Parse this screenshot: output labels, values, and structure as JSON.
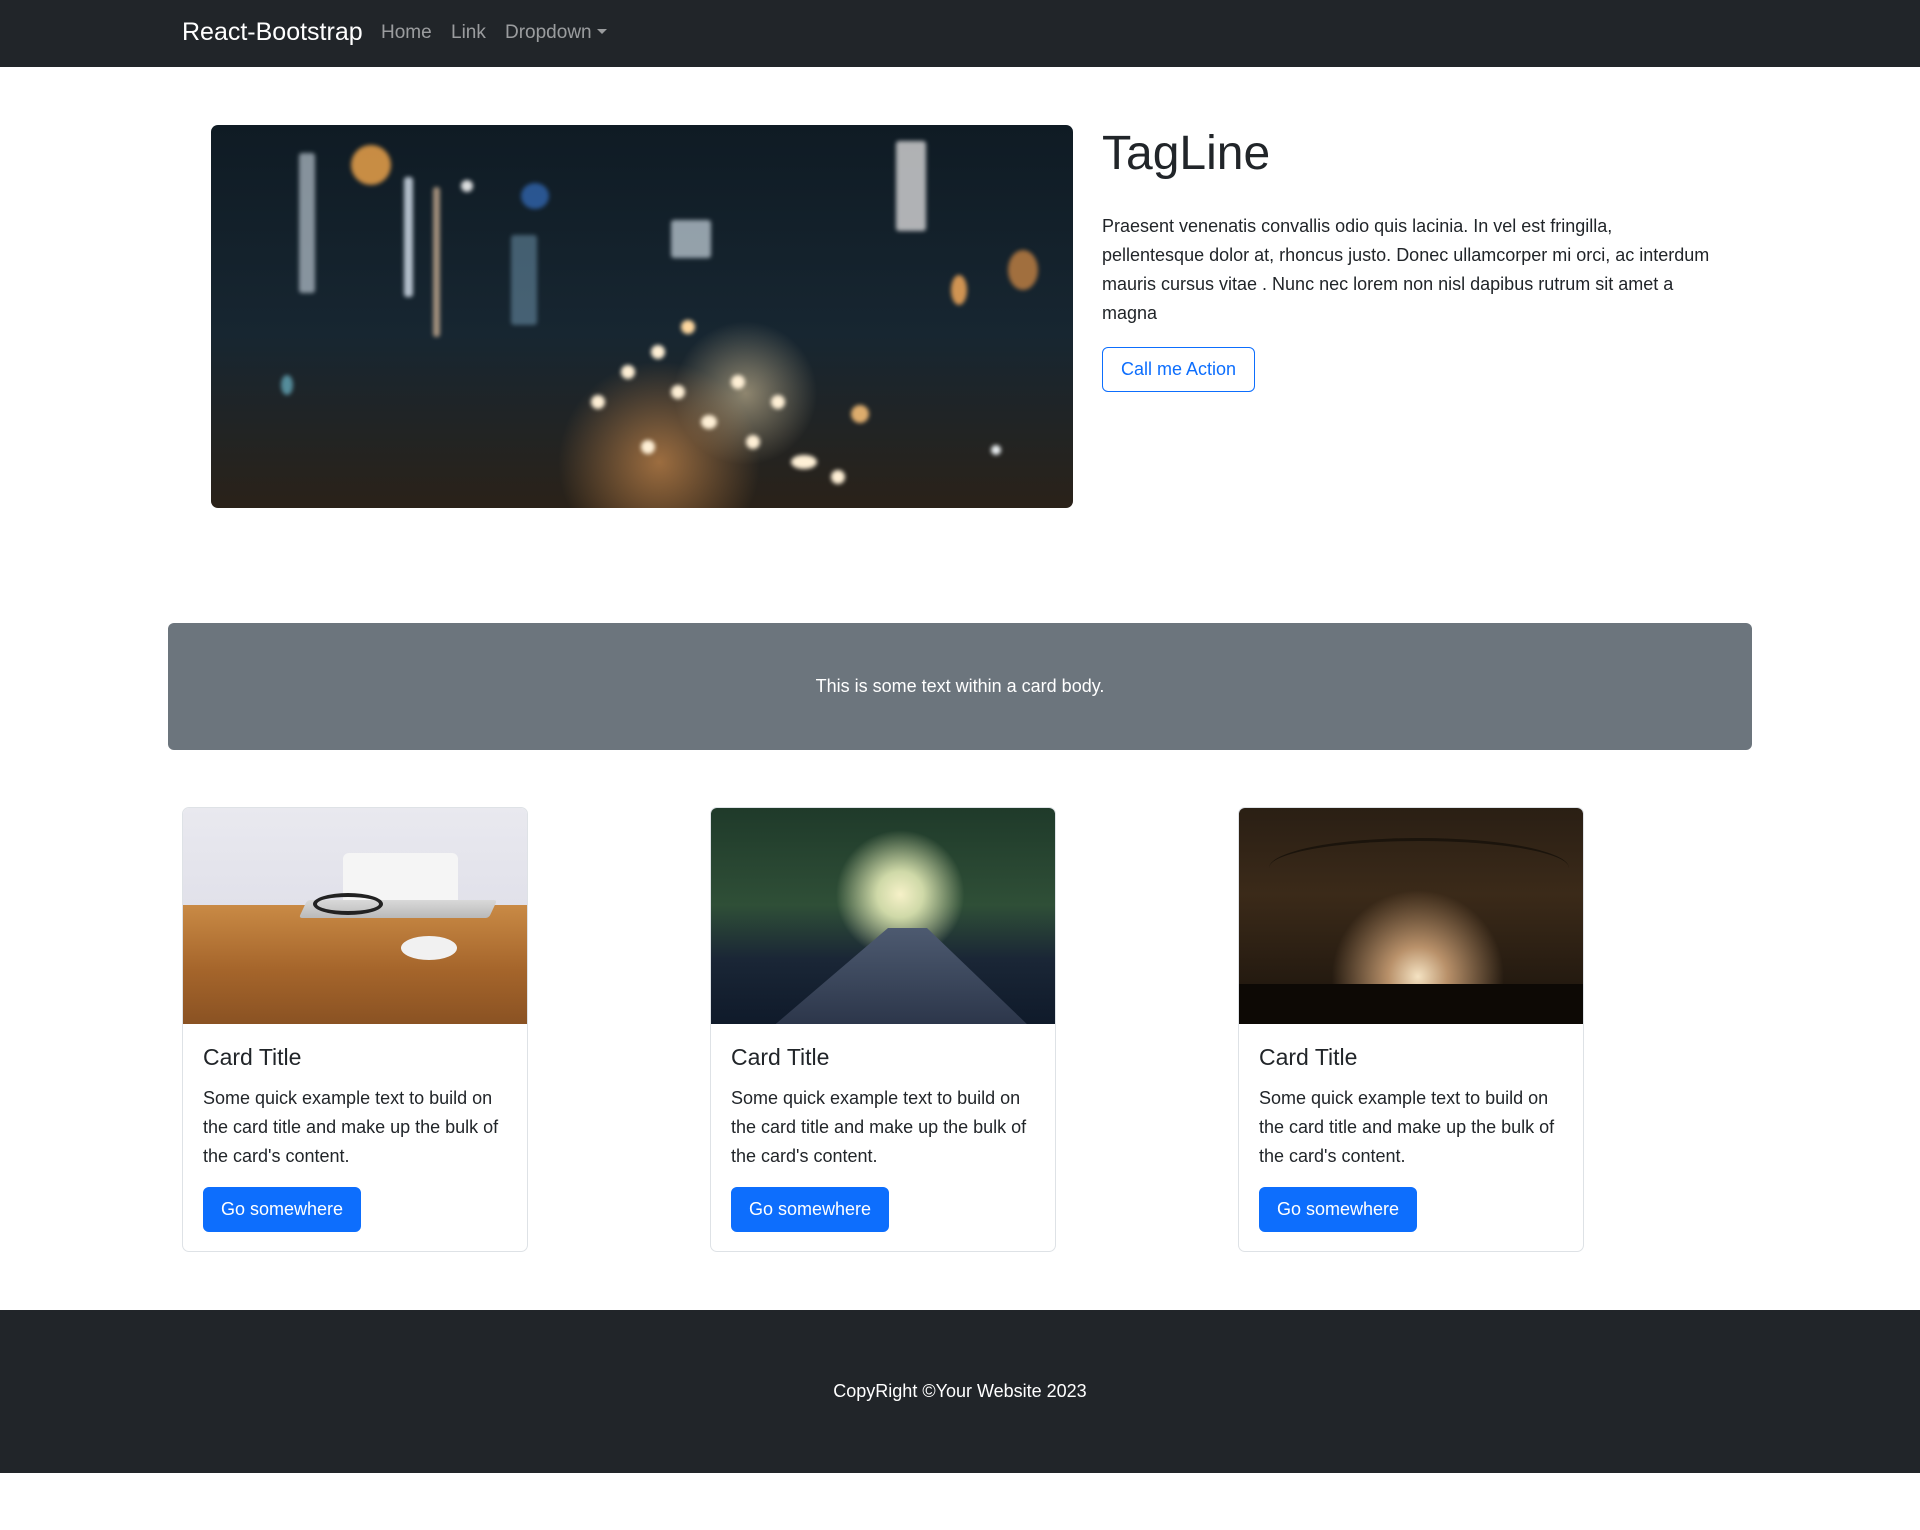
{
  "navbar": {
    "brand": "React-Bootstrap",
    "links": [
      "Home",
      "Link",
      "Dropdown"
    ]
  },
  "hero": {
    "image_alt": "blurred city street at night",
    "title": "TagLine",
    "text": "Praesent venenatis convallis odio quis lacinia. In vel est fringilla, pellentesque dolor at, rhoncus justo. Donec ullamcorper mi orci, ac interdum mauris cursus vitae . Nunc nec lorem non nisl dapibus rutrum sit amet a magna",
    "cta_label": "Call me Action"
  },
  "banner": {
    "text": "This is some text within a card body."
  },
  "cards": [
    {
      "image": "laptop-on-desk",
      "title": "Card Title",
      "text": "Some quick example text to build on the card title and make up the bulk of the card's content.",
      "button": "Go somewhere"
    },
    {
      "image": "road-through-trees",
      "title": "Card Title",
      "text": "Some quick example text to build on the card title and make up the bulk of the card's content.",
      "button": "Go somewhere"
    },
    {
      "image": "concert-stage",
      "title": "Card Title",
      "text": "Some quick example text to build on the card title and make up the bulk of the card's content.",
      "button": "Go somewhere"
    }
  ],
  "footer": {
    "text": "CopyRight ©Your Website 2023"
  },
  "colors": {
    "navbar_bg": "#212529",
    "primary": "#0d6efd",
    "banner_bg": "#6c757d"
  }
}
